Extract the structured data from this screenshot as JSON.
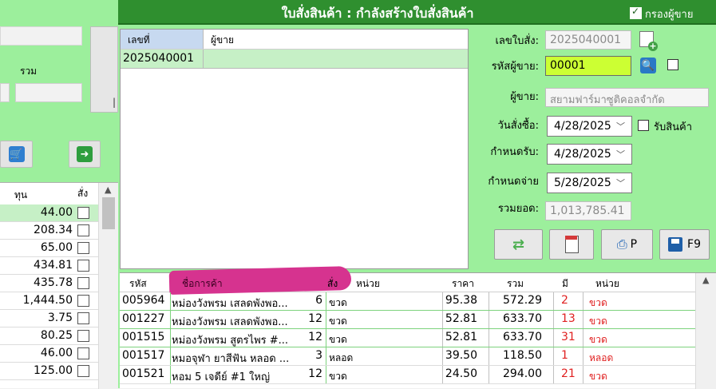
{
  "left_panel": {
    "total_label": "รวม",
    "grid": {
      "headers": [
        "ทุน",
        "สั่ง"
      ],
      "rows": [
        "44.00",
        "208.34",
        "65.00",
        "434.81",
        "435.78",
        "1,444.50",
        "3.75",
        "80.25",
        "46.00",
        "125.00"
      ]
    },
    "icons": {
      "cart": "cart-plus-icon",
      "next": "arrow-right-icon"
    }
  },
  "dialog": {
    "title": "ใบสั่งสินค้า : กำลังสร้างใบสั่งสินค้า",
    "filter_supplier_label": "กรองผู้ขาย",
    "filter_supplier_checked": true
  },
  "order_list": {
    "headers": [
      "เลขที่",
      "ผู้ขาย"
    ],
    "rows": [
      {
        "no": "2025040001",
        "supplier": ""
      }
    ]
  },
  "form": {
    "order_no_label": "เลขใบสั่ง:",
    "order_no": "2025040001",
    "supplier_code_label": "รหัสผู้ขาย:",
    "supplier_code": "00001",
    "supplier_label": "ผู้ขาย:",
    "supplier_name": "สยามฟาร์มาซูติคอลจำกัด",
    "order_date_label": "วันสั่งซื้อ:",
    "order_date": "4/28/2025",
    "receive_label": "รับสินค้า",
    "due_receive_label": "กำหนดรับ:",
    "due_receive": "4/28/2025",
    "due_pay_label": "กำหนดจ่าย",
    "due_pay": "5/28/2025",
    "total_label": "รวมยอด:",
    "total": "1,013,785.41"
  },
  "actions": {
    "print_label": "P",
    "save_label": "F9"
  },
  "items_grid": {
    "headers": [
      "รหัส",
      "ชื่อการค้า",
      "สั่ง",
      "หน่วย",
      "ราคา",
      "รวม",
      "มี",
      "หน่วย"
    ],
    "rows": [
      {
        "code": "005964",
        "name": "หม่องวังพรม เสลดพังพอ...",
        "qty": "6",
        "unit": "ขวด",
        "price": "95.38",
        "total": "572.29",
        "stock": "2",
        "stock_unit": "ขวด"
      },
      {
        "code": "001227",
        "name": "หม่องวังพรม เสลดพังพอ...",
        "qty": "12",
        "unit": "ขวด",
        "price": "52.81",
        "total": "633.70",
        "stock": "13",
        "stock_unit": "ขวด"
      },
      {
        "code": "001515",
        "name": "หม่องวังพรม สูตรไพร #...",
        "qty": "12",
        "unit": "ขวด",
        "price": "52.81",
        "total": "633.70",
        "stock": "31",
        "stock_unit": "ขวด"
      },
      {
        "code": "001517",
        "name": "หมอจุฬา ยาสีฟัน หลอด ...",
        "qty": "3",
        "unit": "หลอด",
        "price": "39.50",
        "total": "118.50",
        "stock": "1",
        "stock_unit": "หลอด"
      },
      {
        "code": "001521",
        "name": "หอม 5 เจดีย์ #1 ใหญ่",
        "qty": "12",
        "unit": "ขวด",
        "price": "24.50",
        "total": "294.00",
        "stock": "21",
        "stock_unit": "ขวด"
      }
    ]
  },
  "colors": {
    "dialog_bg": "#9cef9c",
    "titlebar": "#2f8f2f",
    "selected_row": "#c6f0c6",
    "active_field": "#ccff33",
    "stock_red": "#e02020",
    "redaction": "#d6338f"
  }
}
